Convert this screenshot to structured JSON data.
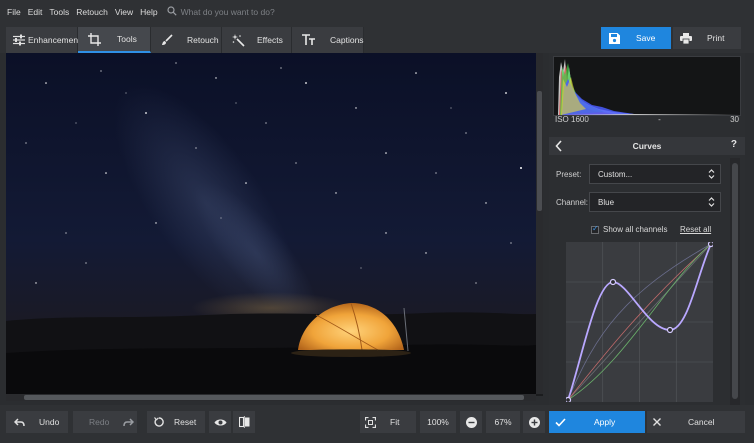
{
  "menu": [
    "File",
    "Edit",
    "Tools",
    "Retouch",
    "View",
    "Help"
  ],
  "search": {
    "placeholder": "What do you want to do?"
  },
  "tabs": [
    {
      "label": "Enhancement",
      "icon": "sliders-icon"
    },
    {
      "label": "Tools",
      "icon": "crop-icon",
      "active": true
    },
    {
      "label": "Retouch",
      "icon": "brush-icon"
    },
    {
      "label": "Effects",
      "icon": "magic-wand-icon"
    },
    {
      "label": "Captions",
      "icon": "text-icon"
    }
  ],
  "actions": {
    "save": "Save",
    "print": "Print"
  },
  "histogram": {
    "left": "ISO 1600",
    "mid": "-",
    "right": "30"
  },
  "curves": {
    "title": "Curves",
    "help": "?",
    "preset_label": "Preset:",
    "preset_value": "Custom...",
    "channel_label": "Channel:",
    "channel_value": "Blue",
    "show_all": "Show all channels",
    "reset_all": "Reset all"
  },
  "bottom": {
    "undo": "Undo",
    "redo": "Redo",
    "reset": "Reset",
    "fit": "Fit",
    "zoom_100": "100%",
    "zoom": "67%",
    "apply": "Apply",
    "cancel": "Cancel"
  },
  "colors": {
    "accent": "#1f86de",
    "curve_blue": "#b9a8ff",
    "background": "#2b2d30"
  }
}
